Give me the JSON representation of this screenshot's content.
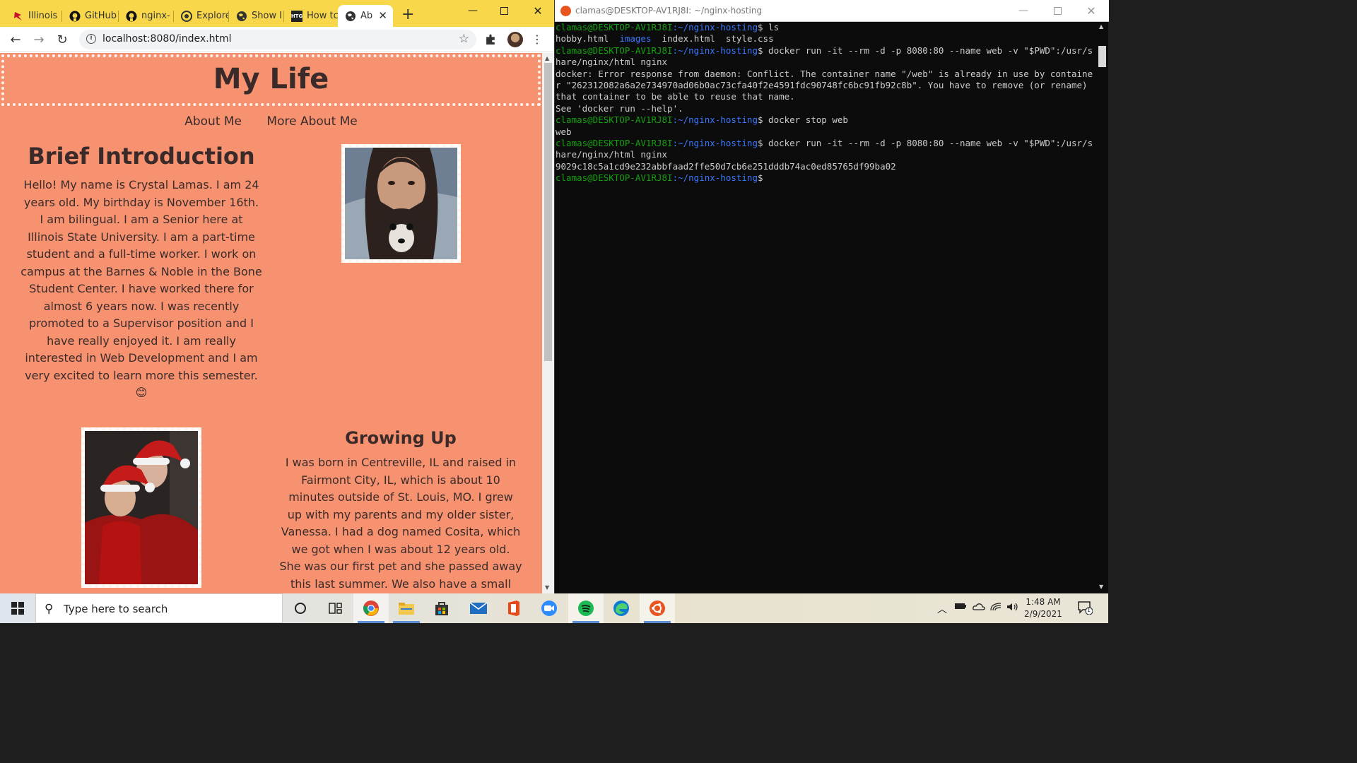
{
  "browser": {
    "tabs": [
      {
        "label": "Illinois",
        "icon": "redbird-icon"
      },
      {
        "label": "GitHub",
        "icon": "github-icon"
      },
      {
        "label": "nginx-",
        "icon": "github-icon"
      },
      {
        "label": "Explore",
        "icon": "explore-icon"
      },
      {
        "label": "Show I",
        "icon": "globe-icon"
      },
      {
        "label": "How tc",
        "icon": "htg-icon"
      },
      {
        "label": "Ab",
        "icon": "globe-icon",
        "active": true
      }
    ],
    "url": "localhost:8080/index.html"
  },
  "page": {
    "title": "My Life",
    "nav": [
      "About Me",
      "More About Me"
    ],
    "intro": {
      "heading": "Brief Introduction",
      "lines": [
        "Hello! My name is Crystal Lamas. I am 24",
        "years old. My birthday is November 16th.",
        "I am bilingual. I am a Senior here at",
        "Illinois State University. I am a part-time",
        "student and a full-time worker. I work on",
        "campus at the Barnes & Noble in the Bone",
        "Student Center. I have worked there for",
        "almost 6 years now. I was recently",
        "promoted to a Supervisor position and I",
        "have really enjoyed it. I am really",
        "interested in Web Development and I am",
        "very excited to learn more this semester.",
        "😊"
      ]
    },
    "growing": {
      "heading": "Growing Up",
      "lines": [
        "I was born in Centreville, IL and raised in",
        "Fairmont City, IL, which is about 10",
        "minutes outside of St. Louis, MO. I grew",
        "up with my parents and my older sister,",
        "Vanessa. I had a dog named Cosita, which",
        "we got when I was about 12 years old.",
        "She was our first pet and she passed away",
        "this last summer. We also have a small"
      ]
    }
  },
  "terminal": {
    "title": "clamas@DESKTOP-AV1RJ8I: ~/nginx-hosting",
    "prompt_user": "clamas@DESKTOP-AV1RJ8I",
    "prompt_path": ":~/nginx-hosting",
    "lines": [
      {
        "type": "cmd",
        "text": "$ ls"
      },
      {
        "type": "ls",
        "items": [
          "hobby.html",
          "images",
          "index.html",
          "style.css"
        ]
      },
      {
        "type": "cmd",
        "text": "$ docker run -it --rm -d -p 8080:80 --name web -v \"$PWD\":/usr/share/nginx/html nginx"
      },
      {
        "type": "out",
        "text": "docker: Error response from daemon: Conflict. The container name \"/web\" is already in use by container \"262312082a6a2e734970ad06b0ac73cfa40f2e4591fdc90748fc6bc91fb92c8b\". You have to remove (or rename) that container to be able to reuse that name."
      },
      {
        "type": "out",
        "text": "See 'docker run --help'."
      },
      {
        "type": "cmd",
        "text": "$ docker stop web"
      },
      {
        "type": "out",
        "text": "web"
      },
      {
        "type": "cmd",
        "text": "$ docker run -it --rm -d -p 8080:80 --name web -v \"$PWD\":/usr/share/nginx/html nginx"
      },
      {
        "type": "out",
        "text": "9029c18c5a1cd9e232abbfaad2ffe50d7cb6e251dddb74ac0ed85765df99ba02"
      },
      {
        "type": "cmd",
        "text": "$ "
      }
    ]
  },
  "taskbar": {
    "search_placeholder": "Type here to search",
    "time": "1:48 AM",
    "date": "2/9/2021",
    "notifications": "1"
  }
}
